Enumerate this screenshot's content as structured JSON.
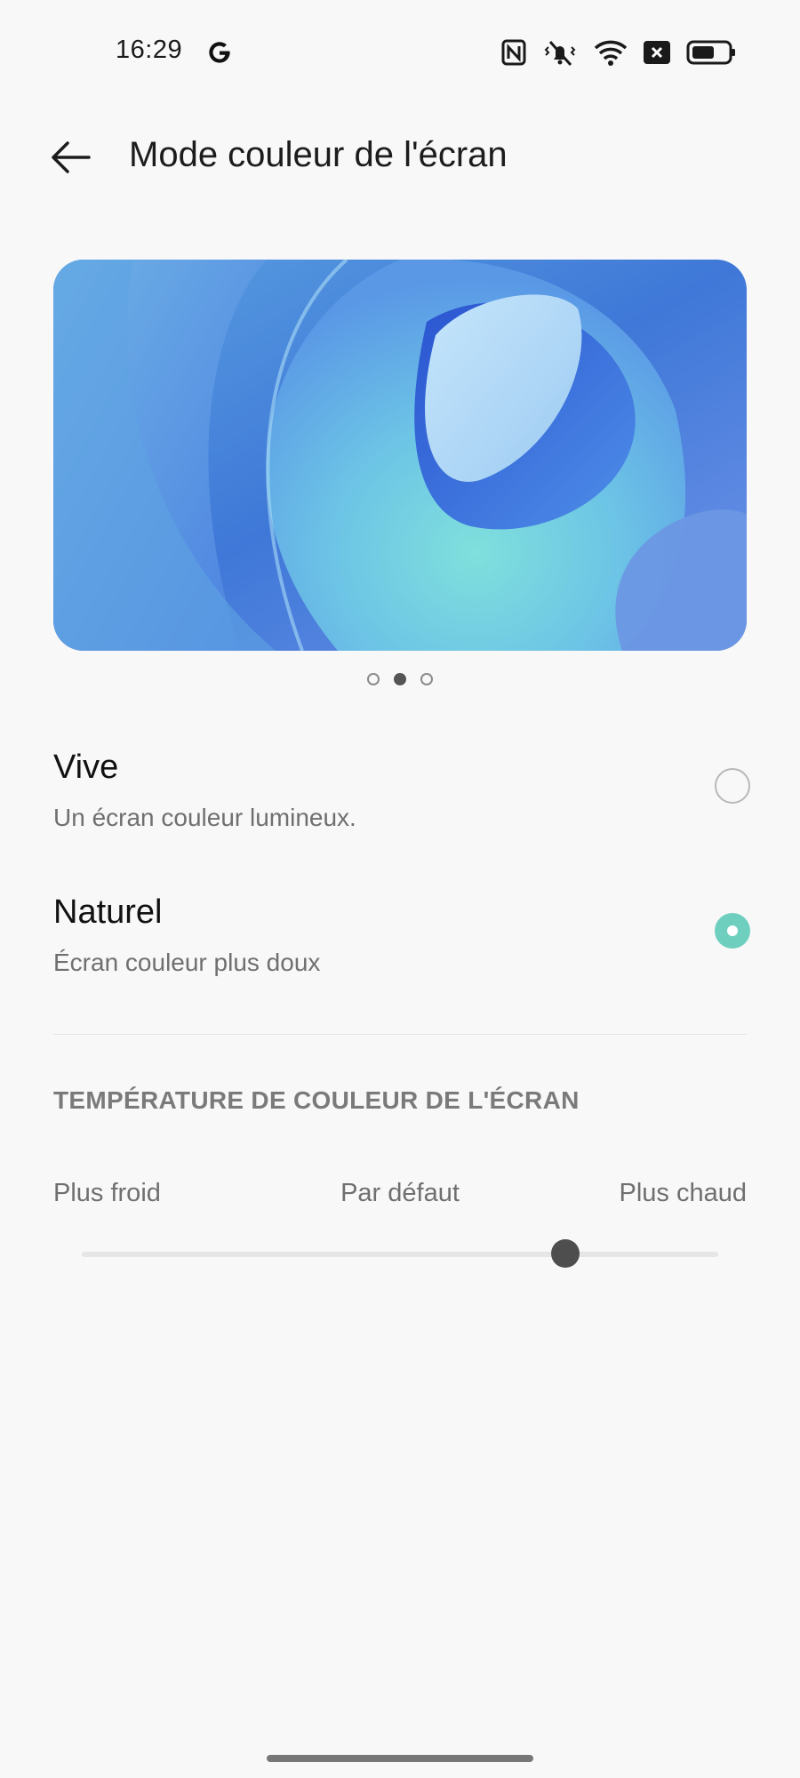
{
  "status_bar": {
    "time": "16:29",
    "icons": [
      "google-icon",
      "nfc-icon",
      "vibrate-off-icon",
      "wifi-icon",
      "close-box-icon",
      "battery-icon"
    ]
  },
  "header": {
    "title": "Mode couleur de l'écran",
    "back_icon": "arrow-left-icon"
  },
  "preview": {
    "page_count": 3,
    "active_page": 2
  },
  "options": [
    {
      "title": "Vive",
      "description": "Un écran couleur lumineux.",
      "selected": false
    },
    {
      "title": "Naturel",
      "description": "Écran couleur plus doux",
      "selected": true
    }
  ],
  "temperature": {
    "section_title": "TEMPÉRATURE DE COULEUR DE L'ÉCRAN",
    "label_cold": "Plus froid",
    "label_default": "Par défaut",
    "label_warm": "Plus chaud",
    "value_fraction": 0.76
  },
  "colors": {
    "accent": "#6fcfbf",
    "background": "#f8f8f8",
    "thumb": "#4e4e4e"
  }
}
